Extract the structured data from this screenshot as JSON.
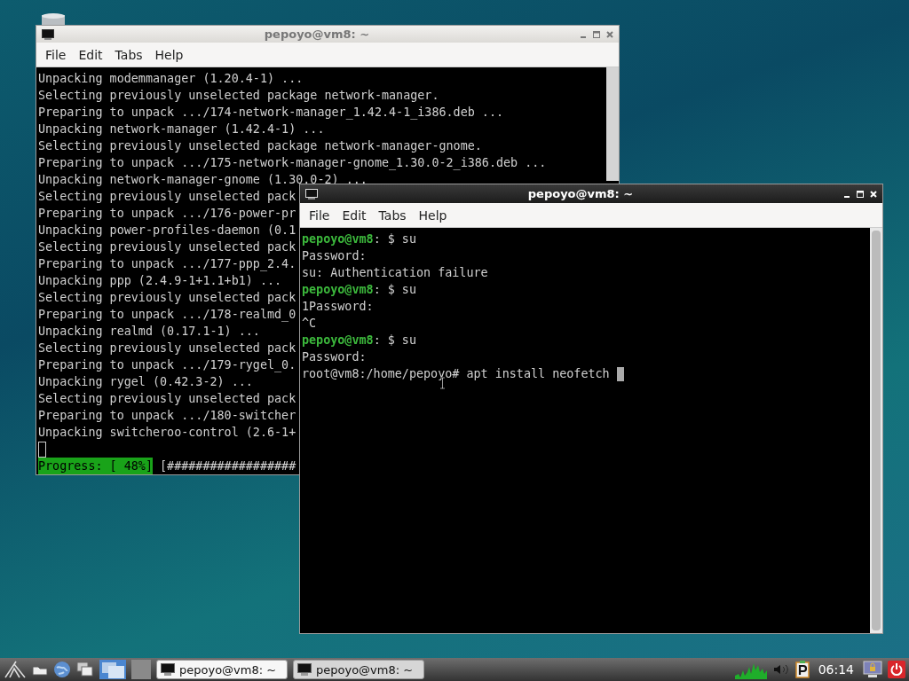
{
  "windows": [
    {
      "title": "pepoyo@vm8: ~",
      "focused": false,
      "menu": [
        "File",
        "Edit",
        "Tabs",
        "Help"
      ],
      "lines": [
        {
          "kind": "output",
          "text": "Unpacking modemmanager (1.20.4-1) ..."
        },
        {
          "kind": "output",
          "text": "Selecting previously unselected package network-manager."
        },
        {
          "kind": "output",
          "text": "Preparing to unpack .../174-network-manager_1.42.4-1_i386.deb ..."
        },
        {
          "kind": "output",
          "text": "Unpacking network-manager (1.42.4-1) ..."
        },
        {
          "kind": "output",
          "text": "Selecting previously unselected package network-manager-gnome."
        },
        {
          "kind": "output",
          "text": "Preparing to unpack .../175-network-manager-gnome_1.30.0-2_i386.deb ..."
        },
        {
          "kind": "output",
          "text": "Unpacking network-manager-gnome (1.30.0-2) ..."
        },
        {
          "kind": "output",
          "text": "Selecting previously unselected pack"
        },
        {
          "kind": "output",
          "text": "Preparing to unpack .../176-power-pr"
        },
        {
          "kind": "output",
          "text": "Unpacking power-profiles-daemon (0.1"
        },
        {
          "kind": "output",
          "text": "Selecting previously unselected pack"
        },
        {
          "kind": "output",
          "text": "Preparing to unpack .../177-ppp_2.4."
        },
        {
          "kind": "output",
          "text": "Unpacking ppp (2.4.9-1+1.1+b1) ..."
        },
        {
          "kind": "output",
          "text": "Selecting previously unselected pack"
        },
        {
          "kind": "output",
          "text": "Preparing to unpack .../178-realmd_0"
        },
        {
          "kind": "output",
          "text": "Unpacking realmd (0.17.1-1) ..."
        },
        {
          "kind": "output",
          "text": "Selecting previously unselected pack"
        },
        {
          "kind": "output",
          "text": "Preparing to unpack .../179-rygel_0."
        },
        {
          "kind": "output",
          "text": "Unpacking rygel (0.42.3-2) ..."
        },
        {
          "kind": "output",
          "text": "Selecting previously unselected pack"
        },
        {
          "kind": "output",
          "text": "Preparing to unpack .../180-switcher"
        },
        {
          "kind": "output",
          "text": "Unpacking switcheroo-control (2.6-1+"
        },
        {
          "kind": "cursor"
        },
        {
          "kind": "progress",
          "label": "Progress: [ 48%]",
          "text": "[##################"
        }
      ]
    },
    {
      "title": "pepoyo@vm8: ~",
      "focused": true,
      "menu": [
        "File",
        "Edit",
        "Tabs",
        "Help"
      ],
      "lines": [
        {
          "kind": "prompt",
          "user": "pepoyo@vm8",
          "text": ": $ su"
        },
        {
          "kind": "output",
          "text": "Password:"
        },
        {
          "kind": "output",
          "text": "su: Authentication failure"
        },
        {
          "kind": "prompt",
          "user": "pepoyo@vm8",
          "text": ": $ su"
        },
        {
          "kind": "output",
          "text": "1Password:"
        },
        {
          "kind": "output",
          "text": "^C"
        },
        {
          "kind": "prompt",
          "user": "pepoyo@vm8",
          "text": ": $ su"
        },
        {
          "kind": "output",
          "text": "Password:"
        },
        {
          "kind": "command",
          "text": "root@vm8:/home/pepoyo# apt install neofetch"
        }
      ]
    }
  ],
  "taskbar": {
    "tasks": [
      {
        "label": "pepoyo@vm8: ~",
        "selected": true
      },
      {
        "label": "pepoyo@vm8: ~",
        "selected": false
      }
    ],
    "clock": "06:14"
  }
}
